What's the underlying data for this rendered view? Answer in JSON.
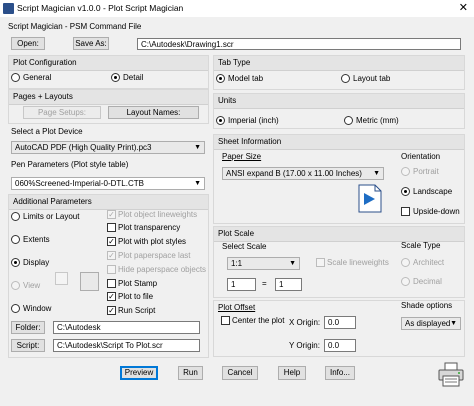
{
  "window": {
    "title": "Script Magician v1.0.0 - Plot Script Magician",
    "close_glyph": "✕"
  },
  "file_section": {
    "label": "Script Magician - PSM Command File",
    "open_label": "Open:",
    "save_as_label": "Save As:",
    "path": "C:\\Autodesk\\Drawing1.scr"
  },
  "plot_configuration": {
    "header": "Plot Configuration",
    "general_label": "General",
    "detail_label": "Detail",
    "selected": "Detail"
  },
  "pages_layouts": {
    "header": "Pages + Layouts",
    "page_setups_label": "Page Setups:",
    "layout_names_label": "Layout Names:"
  },
  "plot_device": {
    "header": "Select a Plot Device",
    "value": "AutoCAD PDF (High Quality Print).pc3"
  },
  "pen_parameters": {
    "label": "Pen Parameters (Plot style table)",
    "value": "060%Screened-Imperial-0-DTL.CTB"
  },
  "additional_parameters": {
    "header": "Additional Parameters",
    "area_options": [
      {
        "label": "Limits or Layout",
        "selected": false,
        "enabled": true
      },
      {
        "label": "Extents",
        "selected": false,
        "enabled": true
      },
      {
        "label": "Display",
        "selected": true,
        "enabled": true
      },
      {
        "label": "View",
        "selected": false,
        "enabled": false
      },
      {
        "label": "Window",
        "selected": false,
        "enabled": true
      }
    ],
    "checkboxes": [
      {
        "label": "Plot object lineweights",
        "checked": true,
        "enabled": false
      },
      {
        "label": "Plot transparency",
        "checked": false,
        "enabled": true
      },
      {
        "label": "Plot with plot styles",
        "checked": true,
        "enabled": true
      },
      {
        "label": "Plot paperspace last",
        "checked": true,
        "enabled": false
      },
      {
        "label": "Hide paperspace objects",
        "checked": false,
        "enabled": false
      },
      {
        "label": "Plot Stamp",
        "checked": false,
        "enabled": true
      },
      {
        "label": "Plot to file",
        "checked": true,
        "enabled": true
      },
      {
        "label": "Run Script",
        "checked": true,
        "enabled": true
      }
    ],
    "folder_label": "Folder:",
    "folder_value": "C:\\Autodesk",
    "script_label": "Script:",
    "script_value": "C:\\Autodesk\\Script To Plot.scr"
  },
  "tab_type": {
    "header": "Tab Type",
    "model_label": "Model tab",
    "layout_label": "Layout tab",
    "selected": "Model tab"
  },
  "units": {
    "header": "Units",
    "imperial_label": "Imperial (inch)",
    "metric_label": "Metric (mm)",
    "selected": "Imperial (inch)"
  },
  "sheet_information": {
    "header": "Sheet Information",
    "paper_size_label": "Paper Size",
    "paper_size_value": "ANSI expand B (17.00 x 11.00 Inches)",
    "orientation_label": "Orientation",
    "portrait_label": "Portrait",
    "landscape_label": "Landscape",
    "upside_down_label": "Upside-down",
    "orientation_selected": "Landscape",
    "upside_down_checked": false
  },
  "plot_scale": {
    "header": "Plot Scale",
    "select_scale_label": "Select Scale",
    "scale_value": "1:1",
    "scale_lineweights_label": "Scale lineweights",
    "scale_num": "1",
    "equals": "=",
    "scale_den": "1",
    "scale_type_label": "Scale Type",
    "architect_label": "Architect",
    "decimal_label": "Decimal"
  },
  "plot_offset": {
    "header": "Plot Offset",
    "center_label": "Center the plot",
    "x_label": "X Origin:",
    "x_value": "0.0",
    "y_label": "Y Origin:",
    "y_value": "0.0",
    "shade_label": "Shade options",
    "shade_value": "As displayed"
  },
  "buttons": {
    "preview": "Preview",
    "run": "Run",
    "cancel": "Cancel",
    "help": "Help",
    "info": "Info..."
  }
}
